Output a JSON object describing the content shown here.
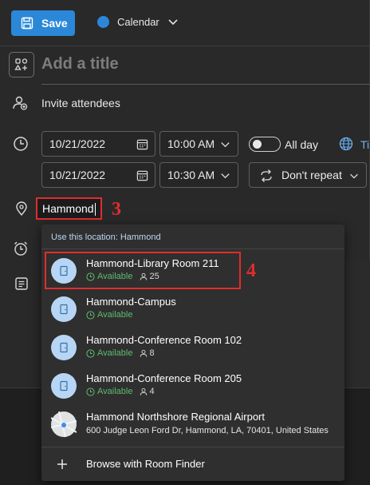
{
  "toolbar": {
    "save_label": "Save",
    "calendar_label": "Calendar",
    "calendar_color": "#2b88d8"
  },
  "event": {
    "title_placeholder": "Add a title",
    "invite_label": "Invite attendees",
    "start_date": "10/21/2022",
    "start_time": "10:00 AM",
    "end_date": "10/21/2022",
    "end_time": "10:30 AM",
    "all_day_label": "All day",
    "timezone_label": "Ti",
    "repeat_label": "Don't repeat",
    "location_value": "Hammond"
  },
  "annotations": {
    "location_marker": "3",
    "suggestion_marker": "4"
  },
  "location_dropdown": {
    "header": "Use this location: Hammond",
    "suggestions": [
      {
        "name": "Hammond-Library Room 211",
        "status": "Available",
        "capacity": "25",
        "icon": "door-icon"
      },
      {
        "name": "Hammond-Campus",
        "status": "Available",
        "capacity": "",
        "icon": "door-icon"
      },
      {
        "name": "Hammond-Conference Room 102",
        "status": "Available",
        "capacity": "8",
        "icon": "door-icon"
      },
      {
        "name": "Hammond-Conference Room 205",
        "status": "Available",
        "capacity": "4",
        "icon": "door-icon"
      },
      {
        "name": "Hammond Northshore Regional Airport",
        "address": "600 Judge Leon Ford Dr, Hammond, LA, 70401, United States",
        "icon": "map-thumbnail"
      }
    ],
    "browse_label": "Browse with Room Finder"
  },
  "colors": {
    "accent": "#2b88d8",
    "available": "#5fbb6f",
    "annotation": "#e02d2d",
    "link": "#6bb1f0"
  }
}
